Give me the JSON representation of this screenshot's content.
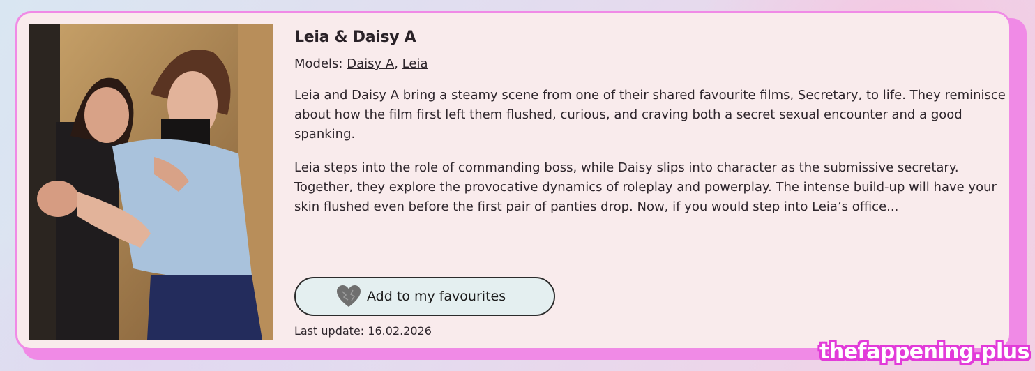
{
  "scene": {
    "title": "Leia & Daisy A",
    "models_label": "Models:",
    "models": [
      {
        "name": "Daisy A"
      },
      {
        "name": "Leia"
      }
    ],
    "models_separator": ", ",
    "description": [
      "Leia and Daisy A bring a steamy scene from one of their shared favourite films, Secretary, to life. They reminisce about how the film first left them flushed, curious, and craving both a secret sexual encounter and a good spanking.",
      "Leia steps into the role of commanding boss, while Daisy slips into character as the submissive secretary. Together, they explore the provocative dynamics of roleplay and powerplay. The intense build-up will have your skin flushed even before the first pair of panties drop. Now, if you would step into Leia’s office..."
    ],
    "favourite_button_label": "Add to my favourites",
    "last_update": "Last update: 16.02.2026"
  },
  "icons": {
    "favourite": "heart-icon"
  },
  "watermark": "thefappening.plus",
  "colors": {
    "card_background": "#f9ebec",
    "card_border": "#f08ae6",
    "button_background": "#e4eff0",
    "text": "#2e262c",
    "watermark_outline": "#e23bd9"
  }
}
